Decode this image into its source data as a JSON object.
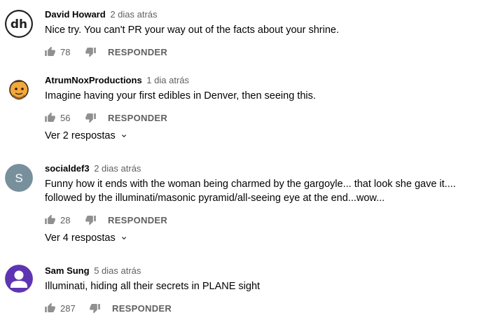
{
  "labels": {
    "reply": "RESPONDER"
  },
  "icons": {
    "like": "thumb-up-icon",
    "dislike": "thumb-down-icon",
    "expand": "chevron-down-icon"
  },
  "colors": {
    "text": "#030303",
    "secondary": "#606060",
    "icon": "#909090",
    "avatar_s": "#78909c",
    "avatar_generic": "#5e35b1"
  },
  "comments": [
    {
      "author": "David Howard",
      "time": "2 dias atrás",
      "text": "Nice try. You can't PR your way out of the facts about your shrine.",
      "likes": "78",
      "avatar_type": "logo",
      "avatar_text": "dh"
    },
    {
      "author": "AtrumNoxProductions",
      "time": "1 dia atrás",
      "text": "Imagine having your first edibles in Denver, then seeing this.",
      "likes": "56",
      "avatar_type": "cartoon",
      "replies": "Ver 2 respostas"
    },
    {
      "author": "socialdef3",
      "time": "2 dias atrás",
      "text": "Funny how it ends with the woman being charmed by the gargoyle... that look she gave it.... followed by the illuminati/masonic pyramid/all-seeing eye at the end...wow...",
      "likes": "28",
      "avatar_type": "letter",
      "avatar_text": "S",
      "replies": "Ver 4 respostas"
    },
    {
      "author": "Sam Sung",
      "time": "5 dias atrás",
      "text": "Illuminati, hiding all their secrets in PLANE sight",
      "likes": "287",
      "avatar_type": "generic"
    }
  ]
}
